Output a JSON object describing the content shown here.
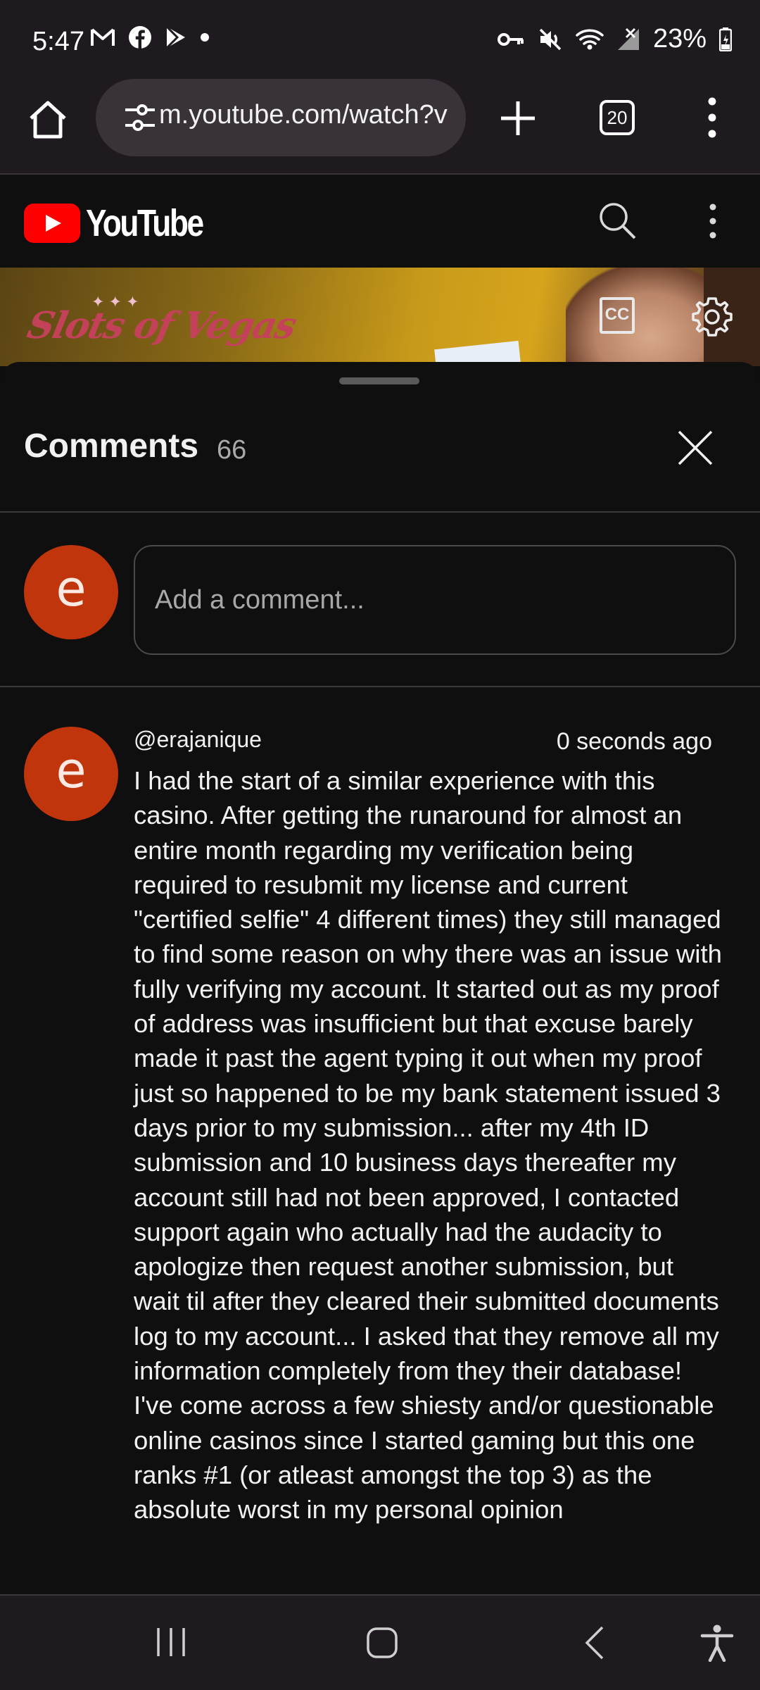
{
  "status_bar": {
    "time": "5:47",
    "battery": "23%",
    "left_icons": [
      "gmail-icon",
      "facebook-icon",
      "play-store-icon",
      "dot-icon"
    ],
    "right_icons": [
      "vpn-key-icon",
      "mute-icon",
      "wifi-icon",
      "signal-icon",
      "battery-icon"
    ]
  },
  "browser": {
    "url": "m.youtube.com/watch?v",
    "tab_count": "20"
  },
  "youtube": {
    "logo_text": "YouTube",
    "video": {
      "brand": "Slots of Vegas",
      "cc_label": "CC"
    }
  },
  "comments": {
    "title": "Comments",
    "count": "66",
    "input_placeholder": "Add a comment...",
    "user_avatar_letter": "e",
    "items": [
      {
        "avatar_letter": "e",
        "author": "@erajanique",
        "time": "0 seconds ago",
        "text": "I had the start of a similar experience with this casino.  After getting the runaround for almost an entire month regarding my verification being required to resubmit my license and current \"certified selfie\" 4 different times) they still managed to find some reason on why there was an issue with fully verifying my account. It started out as my proof of address was insufficient but that excuse barely made it past the agent typing it out when my proof just so happened to be my bank statement issued 3 days prior to my submission... after my 4th ID submission and 10 business days thereafter my account still had not been approved, I contacted support again who actually had the audacity to apologize then request another submission, but wait til after they cleared their submitted documents log to my account... I asked that they remove all my information completely from they their database! I've come across a few shiesty and/or questionable online casinos since I started gaming but this one ranks #1 (or atleast amongst the top 3) as the absolute worst in my personal opinion"
      }
    ]
  },
  "colors": {
    "avatar": "#c1350c",
    "youtube_red": "#ff0000",
    "background": "#0f0f0f",
    "system_bar": "#1f1920"
  }
}
